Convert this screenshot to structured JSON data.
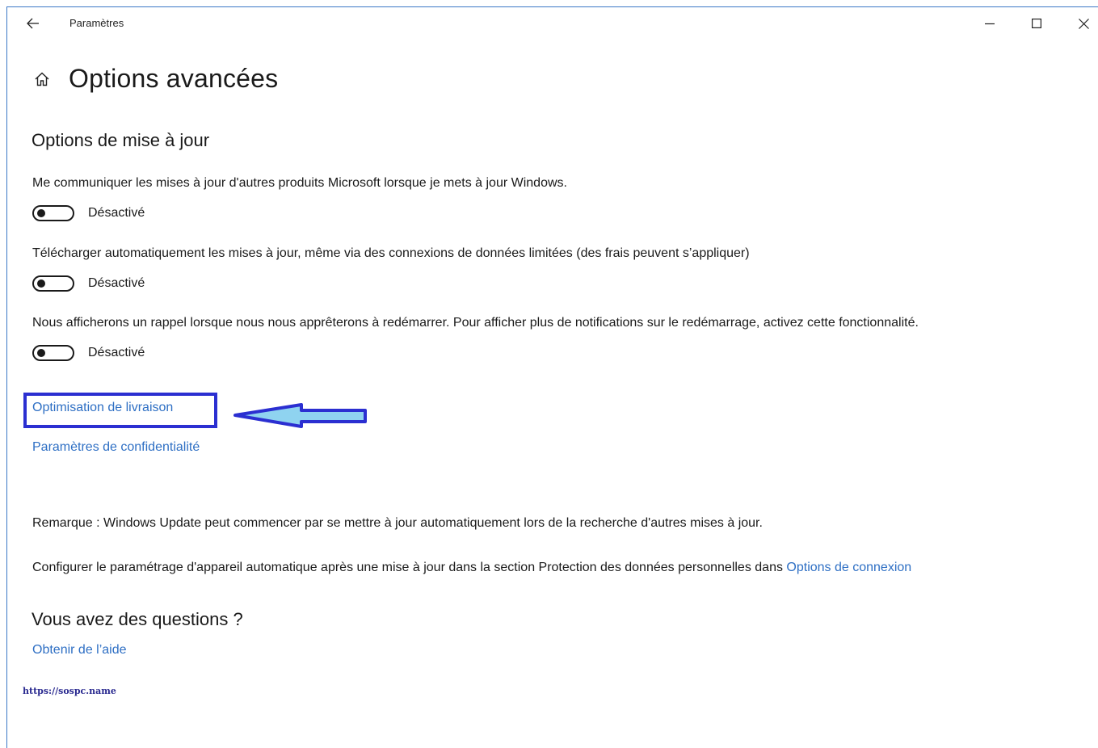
{
  "window": {
    "title": "Paramètres"
  },
  "page": {
    "title": "Options avancées"
  },
  "update_options": {
    "section_title": "Options de mise à jour",
    "settings": [
      {
        "description": "Me communiquer les mises à jour d'autres produits Microsoft lorsque je mets à jour Windows.",
        "state_label": "Désactivé",
        "on": false
      },
      {
        "description": "Télécharger automatiquement les mises à jour, même via des connexions de données limitées (des frais peuvent s’appliquer)",
        "state_label": "Désactivé",
        "on": false
      },
      {
        "description": "Nous afficherons un rappel lorsque nous nous apprêterons à redémarrer. Pour afficher plus de notifications sur le redémarrage, activez cette fonctionnalité.",
        "state_label": "Désactivé",
        "on": false
      }
    ]
  },
  "links": {
    "delivery_optimization": "Optimisation de livraison",
    "privacy_settings": "Paramètres de confidentialité"
  },
  "notes": {
    "remark": "Remarque : Windows Update peut commencer par se mettre à jour automatiquement lors de la recherche d'autres mises à jour.",
    "configure_text": "Configurer le paramétrage d'appareil automatique après une mise à jour dans la section Protection des données personnelles dans ",
    "configure_link": "Options de connexion"
  },
  "help": {
    "section_title": "Vous avez des questions ?",
    "get_help_link": "Obtenir de l’aide"
  },
  "watermark": "https://sospc.name",
  "colors": {
    "link": "#2e6fc4",
    "annotation_box": "#2b2fd1",
    "annotation_arrow_fill": "#8fd3f0",
    "annotation_arrow_stroke": "#2b2fd1"
  },
  "icons": {
    "back": "back-arrow-icon",
    "home": "home-icon",
    "minimize": "minimize-icon",
    "maximize": "maximize-icon",
    "close": "close-icon"
  }
}
